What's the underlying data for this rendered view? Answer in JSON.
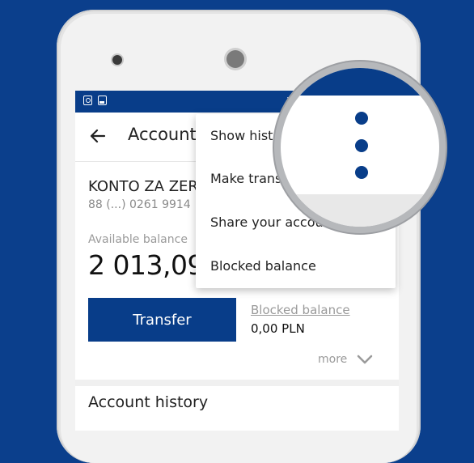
{
  "status_bar": {
    "icons": [
      "sim-card-icon",
      "image-icon",
      "wifi-icon"
    ]
  },
  "toolbar": {
    "title": "Account"
  },
  "account": {
    "name": "KONTO ZA ZER",
    "number": "88 (...) 0261 9914",
    "available_label": "Available balance",
    "available_amount": "2 013,09"
  },
  "actions": {
    "transfer_label": "Transfer",
    "blocked_label": "Blocked balance",
    "blocked_value": "0,00 PLN",
    "more_label": "more"
  },
  "history": {
    "title": "Account history"
  },
  "menu": {
    "items": [
      "Show histor",
      "Make transfe",
      "Share your account number",
      "Blocked balance"
    ]
  },
  "colors": {
    "brand_blue": "#083d89",
    "background_blue": "#0b3f8c"
  },
  "magnifier": {
    "icon": "more-vert-icon"
  }
}
